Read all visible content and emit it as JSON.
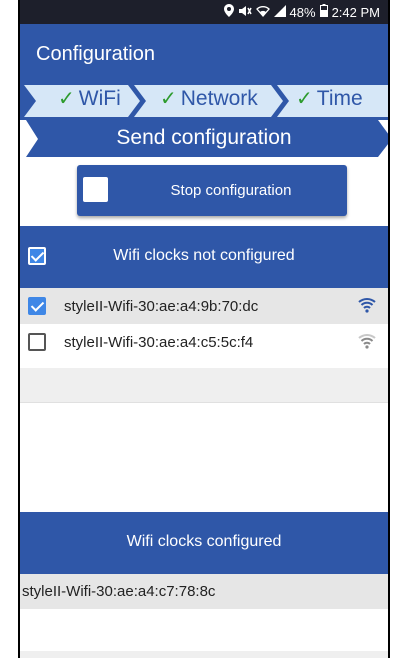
{
  "status_bar": {
    "battery": "48%",
    "time": "2:42 PM"
  },
  "app_bar": {
    "title": "Configuration"
  },
  "steps": {
    "items": [
      {
        "label": "WiFi",
        "checked": true
      },
      {
        "label": "Network",
        "checked": true
      },
      {
        "label": "Time",
        "checked": true
      }
    ],
    "send_label": "Send configuration",
    "check_glyph": "✓"
  },
  "stop_button": {
    "label": "Stop configuration"
  },
  "not_configured": {
    "title": "Wifi clocks not configured",
    "select_all_checked": true,
    "items": [
      {
        "name": "styleII-Wifi-30:ae:a4:9b:70:dc",
        "checked": true,
        "signal": "wifi-strong-icon"
      },
      {
        "name": "styleII-Wifi-30:ae:a4:c5:5c:f4",
        "checked": false,
        "signal": "wifi-medium-icon"
      }
    ]
  },
  "configured": {
    "title": "Wifi clocks configured",
    "items": [
      {
        "name": "styleII-Wifi-30:ae:a4:c7:78:8c"
      }
    ]
  },
  "colors": {
    "primary": "#2f57a8",
    "step_bg": "#d6e7f7",
    "check_green": "#2d9b2d",
    "checkbox_blue": "#3f87e6"
  }
}
